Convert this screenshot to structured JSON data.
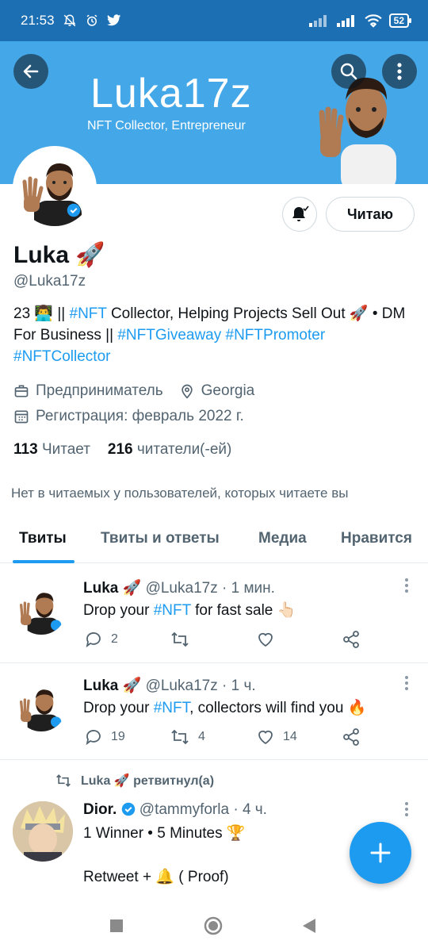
{
  "status": {
    "time": "21:53",
    "battery": "52"
  },
  "banner": {
    "title": "Luka17z",
    "subtitle": "NFT Collector, Entrepreneur"
  },
  "profile": {
    "follow_label": "Читаю",
    "name": "Luka 🚀",
    "handle": "@Luka17z",
    "bio": [
      {
        "t": "23 👨‍💻 || "
      },
      {
        "t": "#NFT",
        "link": true
      },
      {
        "t": " Collector, Helping Projects Sell Out 🚀 • DM For Business || "
      },
      {
        "t": "#NFTGiveaway",
        "link": true
      },
      {
        "t": " "
      },
      {
        "t": "#NFTPromoter",
        "link": true
      },
      {
        "t": " "
      },
      {
        "t": "#NFTCollector",
        "link": true
      }
    ],
    "profession": "Предприниматель",
    "location": "Georgia",
    "joined": "Регистрация: февраль 2022 г.",
    "following_count": "113",
    "following_label": "Читает",
    "followers_count": "216",
    "followers_label": "читатели(-ей)",
    "mutual_notice": "Нет в читаемых у пользователей, которых читаете вы"
  },
  "tabs": [
    "Твиты",
    "Твиты и ответы",
    "Медиа",
    "Нравится"
  ],
  "tweets": [
    {
      "name": "Luka 🚀",
      "handle": "@Luka17z",
      "time": "1 мин.",
      "text_before": "Drop your ",
      "hashtag": "#NFT",
      "text_after": " for fast sale 👆🏻",
      "replies": "2",
      "retweets": "",
      "likes": ""
    },
    {
      "name": "Luka 🚀",
      "handle": "@Luka17z",
      "time": "1 ч.",
      "text_before": "Drop your ",
      "hashtag": "#NFT",
      "text_after": ", collectors will find you 🔥",
      "replies": "19",
      "retweets": "4",
      "likes": "14"
    }
  ],
  "retweet": {
    "retweeted_by": "Luka 🚀 ретвитнул(а)",
    "name": "Dior.",
    "handle": "@tammyforla",
    "time": "4 ч.",
    "line1": "1 Winner • 5 Minutes 🏆",
    "line2": "Retweet + 🔔 ( Proof)"
  }
}
